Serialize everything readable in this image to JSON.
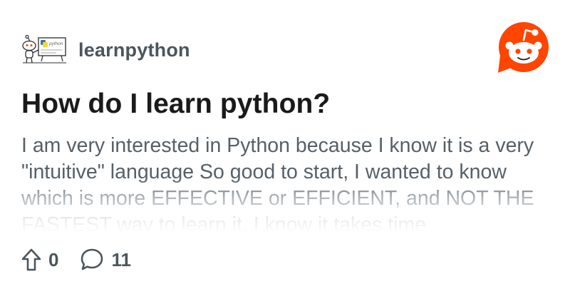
{
  "subreddit": {
    "name": "learnpython",
    "avatar_icon": "python-snoo-icon"
  },
  "brand": {
    "logo_icon": "reddit-logo-icon",
    "accent": "#ff4500"
  },
  "post": {
    "title": "How do I learn python?",
    "body": "I am very interested in Python because I know it is a very \"intuitive\" language So good to start, I wanted to know which is more EFFECTIVE or EFFICIENT, and NOT THE FASTEST way to learn it. I know it takes time"
  },
  "stats": {
    "upvotes": "0",
    "comments": "11",
    "upvote_icon": "upvote-arrow-icon",
    "comment_icon": "comment-bubble-icon"
  },
  "colors": {
    "title": "#1a1a1b",
    "body": "#576068",
    "meta": "#4b555c"
  }
}
